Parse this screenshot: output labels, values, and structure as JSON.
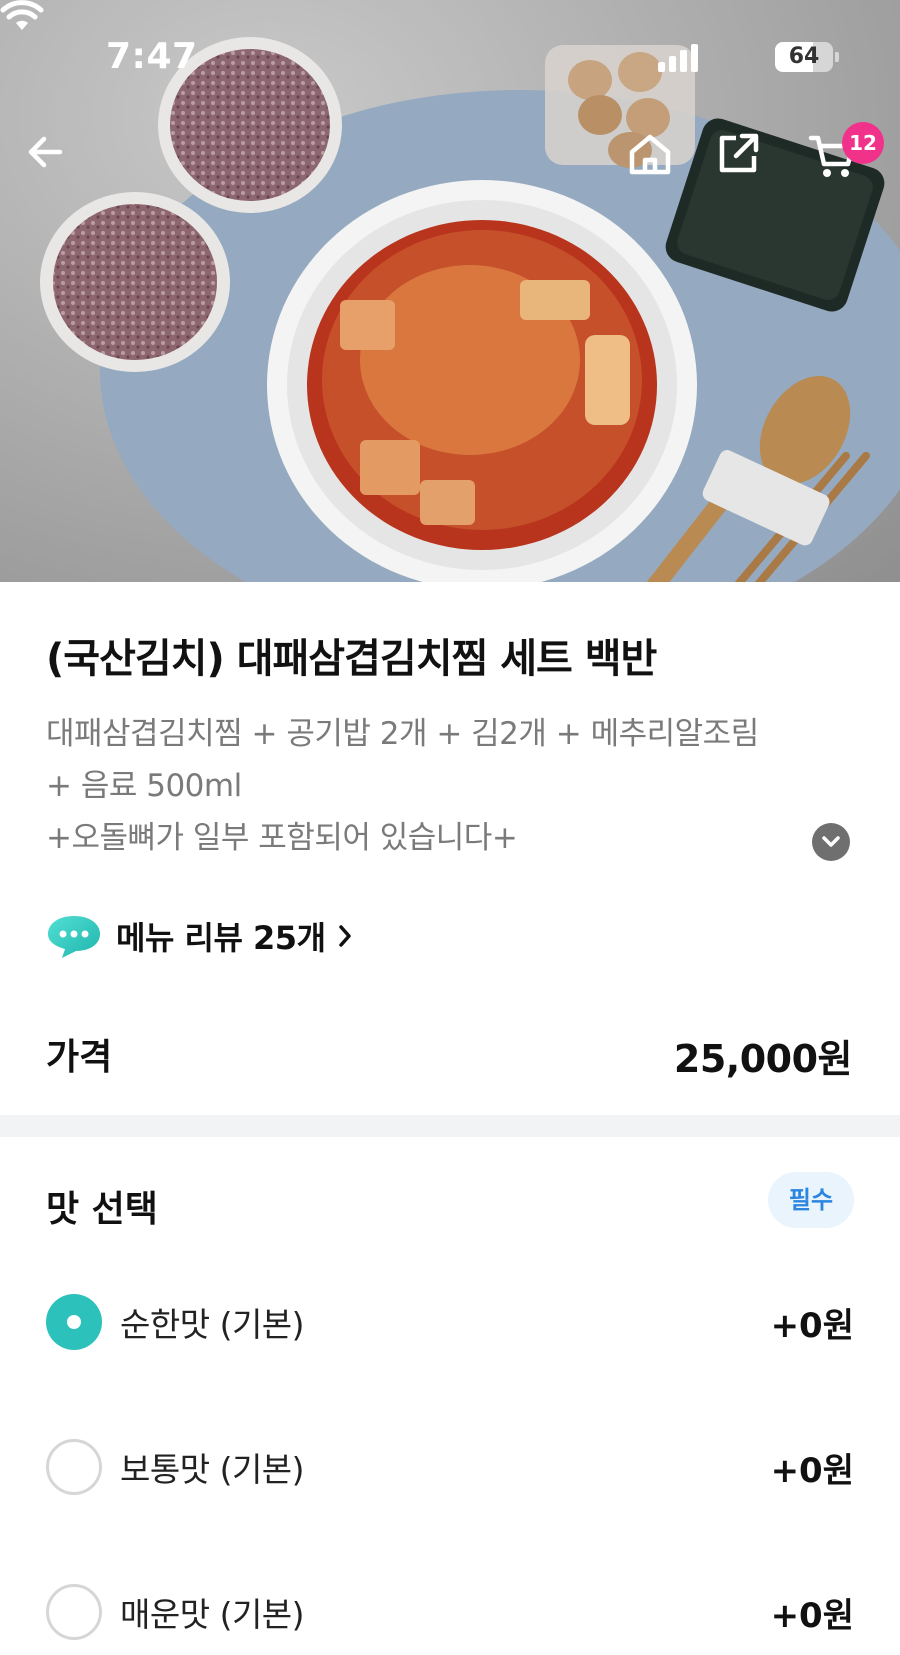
{
  "status_bar": {
    "time": "7:47",
    "battery": "64",
    "icons": [
      "signal-icon",
      "wifi-icon",
      "battery-icon"
    ]
  },
  "nav": {
    "icons": [
      "back-arrow-icon",
      "home-icon",
      "share-icon",
      "cart-icon"
    ],
    "cart_count": "12",
    "accent_color": "#f0328a"
  },
  "product": {
    "title": "(국산김치) 대패삼겹김치찜 세트 백반",
    "description_lines": [
      "대패삼겹김치찜 + 공기밥 2개 + 김2개 + 메추리알조림",
      "+ 음료 500ml",
      "+오돌뼈가 일부 포함되어 있습니다+"
    ],
    "review_label": "메뉴 리뷰 25개",
    "price_label": "가격",
    "price": "25,000원"
  },
  "options": {
    "title": "맛 선택",
    "badge": "필수",
    "selected_color": "#2cc2bb",
    "items": [
      {
        "label": "순한맛 (기본)",
        "price": "+0원",
        "selected": true
      },
      {
        "label": "보통맛 (기본)",
        "price": "+0원",
        "selected": false
      },
      {
        "label": "매운맛 (기본)",
        "price": "+0원",
        "selected": false
      }
    ]
  }
}
